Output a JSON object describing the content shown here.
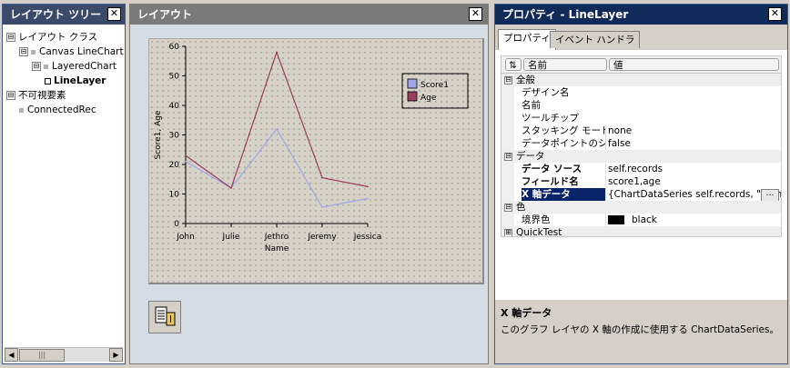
{
  "left_panel": {
    "title": "レイアウト ツリー",
    "close": "✕",
    "tree": [
      {
        "label": "レイアウト クラス",
        "level": 0,
        "toggle": "⊟",
        "bold": false
      },
      {
        "label": "Canvas LineChart",
        "level": 1,
        "toggle": "⊟",
        "bold": false
      },
      {
        "label": "LayeredChart",
        "level": 2,
        "toggle": "⊟",
        "bold": false
      },
      {
        "label": "LineLayer",
        "level": 3,
        "toggle": "",
        "bold": true
      },
      {
        "label": "不可視要素",
        "level": 0,
        "toggle": "⊟",
        "bold": false
      },
      {
        "label": "ConnectedRec",
        "level": 1,
        "toggle": "",
        "bold": false
      }
    ],
    "scroll": {
      "left": "◀",
      "right": "▶",
      "thumb": "|||"
    }
  },
  "middle_panel": {
    "title": "レイアウト",
    "close": "✕"
  },
  "chart_data": {
    "type": "line",
    "categories": [
      "John",
      "Julie",
      "Jethro",
      "Jeremy",
      "Jessica"
    ],
    "series": [
      {
        "name": "Score1",
        "values": [
          21,
          12,
          32,
          5.5,
          8.5
        ],
        "color": "#9fa7e6"
      },
      {
        "name": "Age",
        "values": [
          23,
          12,
          58,
          15.5,
          12.5
        ],
        "color": "#9a3c5e"
      }
    ],
    "xlabel": "Name",
    "ylabel": "Score1, Age",
    "ylim": [
      0,
      60
    ],
    "yticks": [
      0,
      10,
      20,
      30,
      40,
      50,
      60
    ],
    "legend": "top-right",
    "grid": false
  },
  "right_panel": {
    "title": "プロパティ - LineLayer",
    "close": "✕",
    "tabs": [
      "プロパティ",
      "イベント ハンドラ"
    ],
    "header": {
      "sort": "⇅",
      "name": "名前",
      "value": "値"
    },
    "rows": [
      {
        "type": "cat",
        "toggle": "⊟",
        "name": "全般",
        "value": ""
      },
      {
        "type": "prop",
        "name": "デザイン名",
        "value": "",
        "bold": false
      },
      {
        "type": "prop",
        "name": "名前",
        "value": "",
        "bold": false
      },
      {
        "type": "prop",
        "name": "ツールチップ",
        "value": "",
        "bold": false
      },
      {
        "type": "prop",
        "name": "スタッキング モード",
        "value": "none",
        "bold": false
      },
      {
        "type": "prop",
        "name": "データポイントのシン",
        "value": "false",
        "bold": false
      },
      {
        "type": "cat",
        "toggle": "⊟",
        "name": "データ",
        "value": ""
      },
      {
        "type": "prop",
        "name": "データ ソース",
        "value": "self.records",
        "bold": true
      },
      {
        "type": "prop",
        "name": "フィールド名",
        "value": "score1,age",
        "bold": true
      },
      {
        "type": "sel",
        "name": "X 軸データ",
        "value": "{ChartDataSeries self.records, \"name\"}",
        "bold": true,
        "button": "…"
      },
      {
        "type": "cat",
        "toggle": "⊟",
        "name": "色",
        "value": ""
      },
      {
        "type": "color",
        "name": "境界色",
        "value": "black",
        "bold": false,
        "swatch": "#000000"
      },
      {
        "type": "cat",
        "toggle": "⊞",
        "name": "QuickTest",
        "value": ""
      }
    ],
    "description": {
      "title": "X 軸データ",
      "text": "このグラフ レイヤの X 軸の作成に使用する ChartDataSeries。"
    }
  }
}
